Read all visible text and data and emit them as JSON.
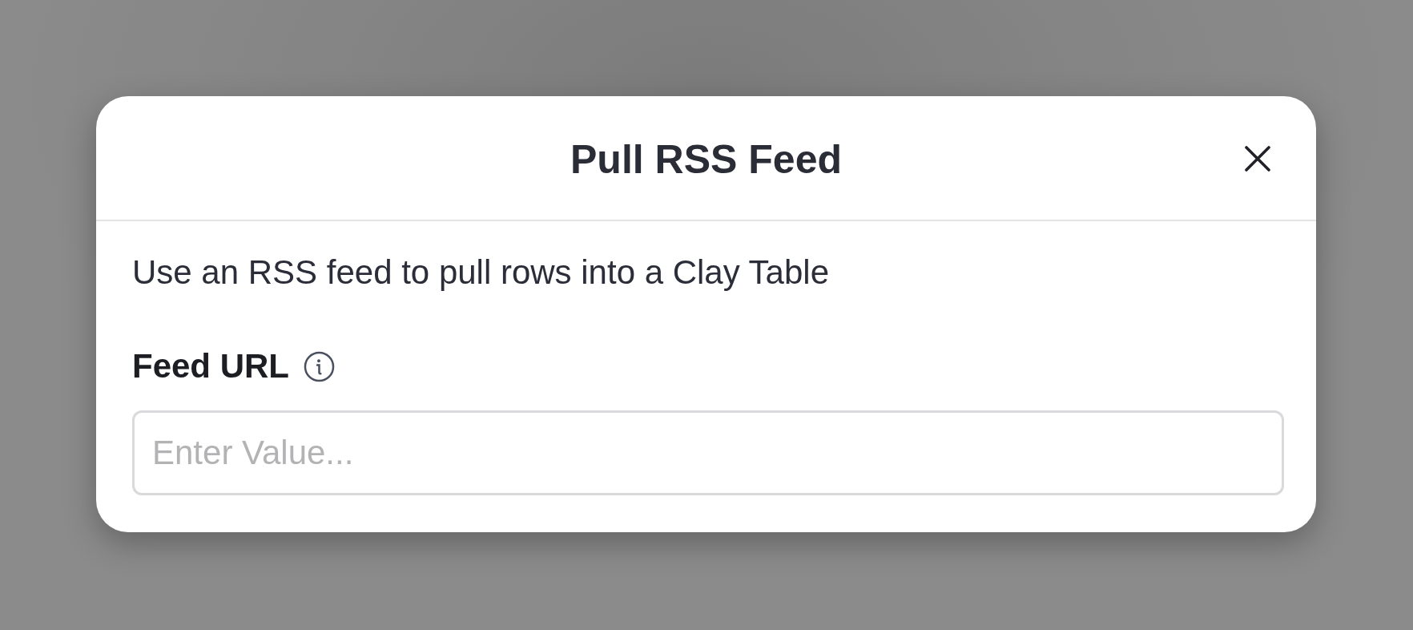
{
  "dialog": {
    "title": "Pull RSS Feed",
    "description": "Use an RSS feed to pull rows into a Clay Table",
    "field": {
      "label": "Feed URL",
      "placeholder": "Enter Value..."
    }
  }
}
